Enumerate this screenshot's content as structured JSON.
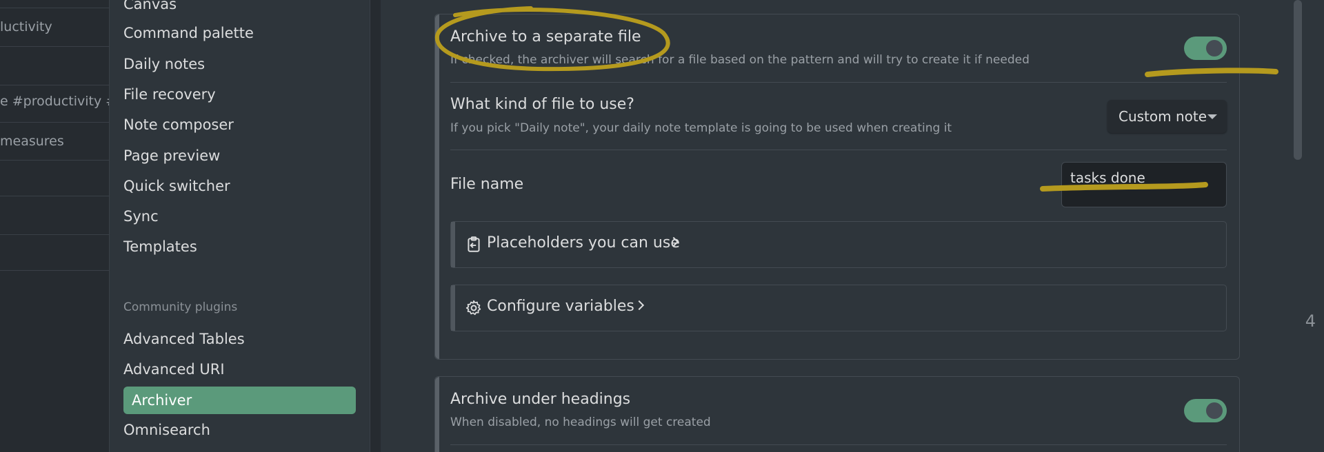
{
  "notes_pane": {
    "rows": [
      {
        "text": ""
      },
      {
        "text": "luctivity"
      },
      {
        "text": ""
      },
      {
        "text": "e #productivity #art"
      },
      {
        "text": "measures"
      },
      {
        "text": ""
      },
      {
        "text": ""
      },
      {
        "text": ""
      }
    ]
  },
  "sidebar": {
    "core_items": [
      "Canvas",
      "Command palette",
      "Daily notes",
      "File recovery",
      "Note composer",
      "Page preview",
      "Quick switcher",
      "Sync",
      "Templates"
    ],
    "community_heading": "Community plugins",
    "community_items": [
      "Advanced Tables",
      "Advanced URI",
      "Archiver",
      "Omnisearch"
    ],
    "active_item": "Archiver"
  },
  "settings": {
    "archive_separate": {
      "name": "Archive to a separate file",
      "desc": "If checked, the archiver will search for a file based on the pattern and will try to create it if needed",
      "enabled": true
    },
    "file_kind": {
      "name": "What kind of file to use?",
      "desc": "If you pick \"Daily note\", your daily note template is going to be used when creating it",
      "selected": "Custom note"
    },
    "file_name": {
      "name": "File name",
      "value": "tasks done"
    },
    "placeholders": {
      "label": "Placeholders you can use"
    },
    "variables": {
      "label": "Configure variables"
    },
    "archive_headings": {
      "name": "Archive under headings",
      "desc": "When disabled, no headings will get created",
      "enabled": true
    }
  },
  "stray_digit": "4",
  "colors": {
    "accent": "#5b9a7b",
    "annotation": "#b59a1e"
  }
}
